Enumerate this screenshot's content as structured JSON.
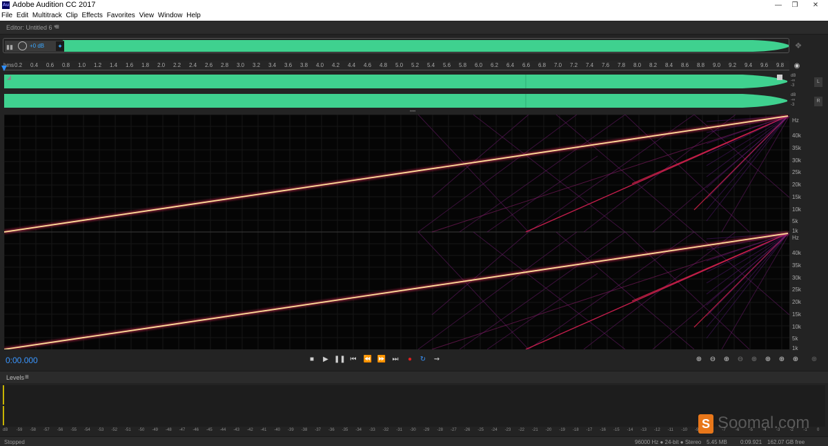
{
  "window": {
    "app_icon": "Au",
    "title": "Adobe Audition CC 2017",
    "controls": [
      "minimize-icon",
      "restore-icon",
      "close-icon"
    ]
  },
  "menu": [
    "File",
    "Edit",
    "Multitrack",
    "Clip",
    "Effects",
    "Favorites",
    "View",
    "Window",
    "Help"
  ],
  "editor": {
    "tab_label": "Editor: Untitled 6 *"
  },
  "hud": {
    "volume": "+0 dB"
  },
  "ruler": {
    "unit": "hms",
    "ticks": [
      "0.2",
      "0.4",
      "0.6",
      "0.8",
      "1.0",
      "1.2",
      "1.4",
      "1.6",
      "1.8",
      "2.0",
      "2.2",
      "2.4",
      "2.6",
      "2.8",
      "3.0",
      "3.2",
      "3.4",
      "3.6",
      "3.8",
      "4.0",
      "4.2",
      "4.4",
      "4.6",
      "4.8",
      "5.0",
      "5.2",
      "5.4",
      "5.6",
      "5.8",
      "6.0",
      "6.2",
      "6.4",
      "6.6",
      "6.8",
      "7.0",
      "7.2",
      "7.4",
      "7.6",
      "7.8",
      "8.0",
      "8.2",
      "8.4",
      "8.6",
      "8.8",
      "9.0",
      "9.2",
      "9.4",
      "9.6",
      "9.8"
    ]
  },
  "waveform": {
    "color": "#3fd18f",
    "db_scale": [
      "dB",
      "-∞",
      "-3"
    ],
    "channel_buttons": [
      "L",
      "R"
    ]
  },
  "spectral": {
    "hz_scale": [
      "Hz",
      "40k",
      "35k",
      "30k",
      "25k",
      "20k",
      "15k",
      "10k",
      "5k",
      "1k"
    ]
  },
  "transport": {
    "timecode": "0:00.000",
    "buttons": [
      "stop",
      "play",
      "pause",
      "move-to-previous",
      "rewind",
      "fast-forward",
      "move-to-next",
      "record",
      "loop-playback",
      "skip-selection"
    ]
  },
  "levels": {
    "label": "Levels",
    "scale": [
      "dB",
      "-59",
      "-58",
      "-57",
      "-56",
      "-55",
      "-54",
      "-53",
      "-52",
      "-51",
      "-50",
      "-49",
      "-48",
      "-47",
      "-46",
      "-45",
      "-44",
      "-43",
      "-42",
      "-41",
      "-40",
      "-39",
      "-38",
      "-37",
      "-36",
      "-35",
      "-34",
      "-33",
      "-32",
      "-31",
      "-30",
      "-29",
      "-28",
      "-27",
      "-26",
      "-25",
      "-24",
      "-23",
      "-22",
      "-21",
      "-20",
      "-19",
      "-18",
      "-17",
      "-16",
      "-15",
      "-14",
      "-13",
      "-12",
      "-11",
      "-10",
      "-9",
      "-8",
      "-7",
      "-6",
      "-5",
      "-4",
      "-3",
      "-2",
      "-1",
      "0"
    ]
  },
  "watermark": {
    "logo": "S",
    "text": "Soomal.com"
  },
  "status": {
    "state": "Stopped",
    "format": "96000 Hz ● 24-bit ● Stereo",
    "size": "5.45 MB",
    "duration": "0:09.921",
    "free": "162.07 GB free"
  }
}
